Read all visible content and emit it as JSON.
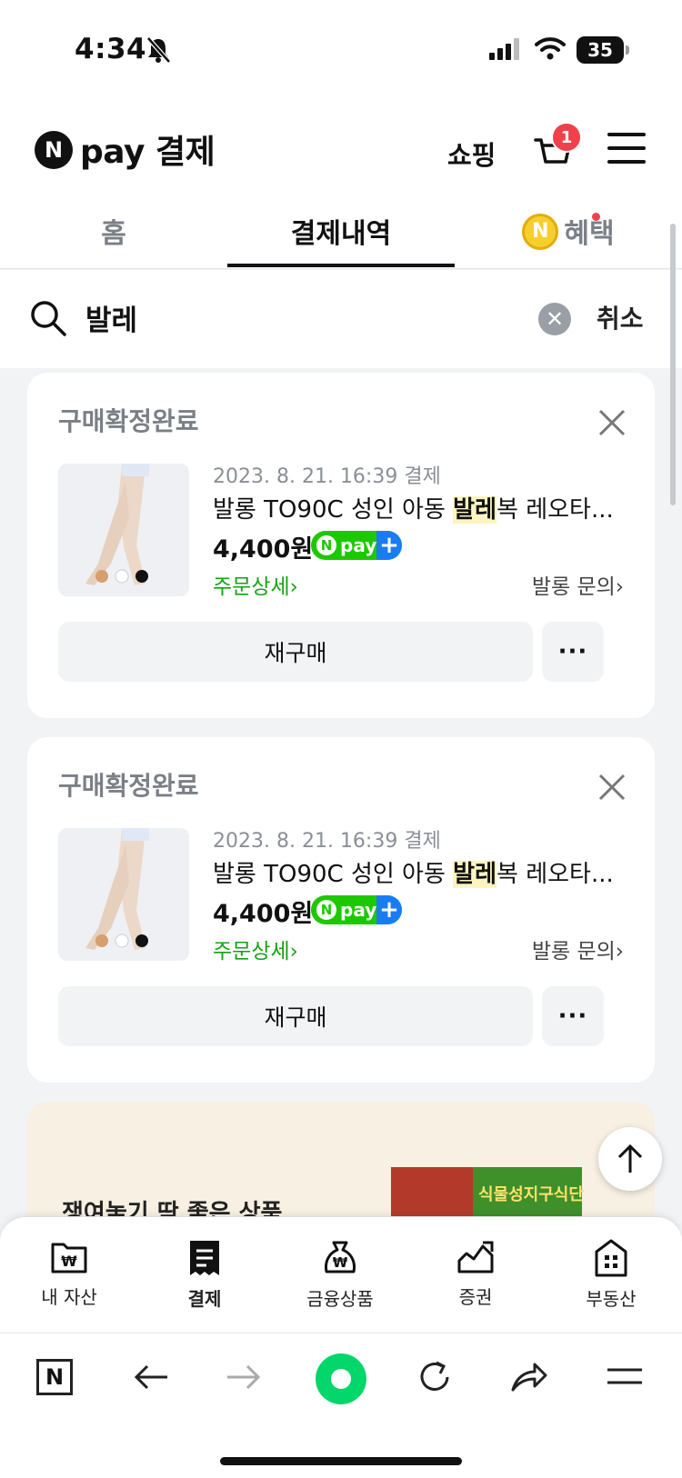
{
  "status_bar": {
    "time": "4:34",
    "battery": "35"
  },
  "header": {
    "logo_letter": "N",
    "logo_text": "pay 결제",
    "shopping_label": "쇼핑",
    "cart_count": "1"
  },
  "tabs": [
    {
      "label": "홈",
      "active": false
    },
    {
      "label": "결제내역",
      "active": true
    },
    {
      "label": "혜택",
      "active": false
    }
  ],
  "search": {
    "query": "발레",
    "cancel_label": "취소"
  },
  "orders": [
    {
      "status": "구매확정완료",
      "date": "2023. 8. 21. 16:39 결제",
      "name_before": "발롱 TO90C 성인 아동 ",
      "name_highlight": "발레",
      "name_after": "복 레오타...",
      "price": "4,400원",
      "pay_badge": "pay",
      "detail_link": "주문상세",
      "inquiry_link": "발롱 문의",
      "rebuy_label": "재구매",
      "more_label": "···"
    },
    {
      "status": "구매확정완료",
      "date": "2023. 8. 21. 16:39 결제",
      "name_before": "발롱 TO90C 성인 아동 ",
      "name_highlight": "발레",
      "name_after": "복 레오타...",
      "price": "4,400원",
      "pay_badge": "pay",
      "detail_link": "주문상세",
      "inquiry_link": "발롱 문의",
      "rebuy_label": "재구매",
      "more_label": "···"
    }
  ],
  "ad": {
    "text": "쟁여놓기 딱 좋은 상품",
    "product_label": "식물성지구식단"
  },
  "bottom_nav": [
    {
      "label": "내 자산",
      "icon": "wallet-icon",
      "active": false
    },
    {
      "label": "결제",
      "icon": "receipt-icon",
      "active": true
    },
    {
      "label": "금융상품",
      "icon": "money-bag-icon",
      "active": false
    },
    {
      "label": "증권",
      "icon": "stock-chart-icon",
      "active": false
    },
    {
      "label": "부동산",
      "icon": "building-icon",
      "active": false
    }
  ],
  "browser_toolbar": {
    "naver_letter": "N"
  },
  "colors": {
    "accent_green": "#1ec800",
    "badge_red": "#f0414a",
    "highlight": "#fdf4bf"
  }
}
